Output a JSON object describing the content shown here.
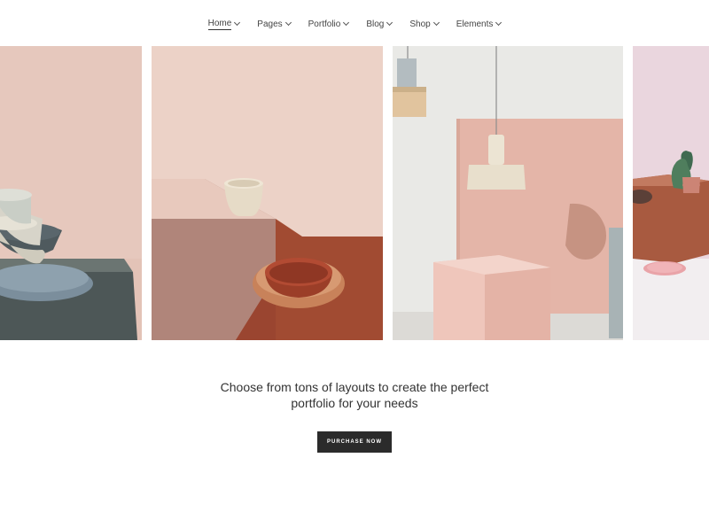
{
  "nav": {
    "items": [
      {
        "label": "Home",
        "active": true
      },
      {
        "label": "Pages"
      },
      {
        "label": "Portfolio"
      },
      {
        "label": "Blog"
      },
      {
        "label": "Shop"
      },
      {
        "label": "Elements"
      }
    ]
  },
  "gallery": {
    "tiles": [
      "ceramic-bowls-image",
      "ceramic-cup-bowl-image",
      "pendant-lamp-image",
      "green-vase-image"
    ]
  },
  "tagline": {
    "line1": "Choose from tons of layouts to create the perfect",
    "line2": "portfolio for your needs"
  },
  "cta": {
    "label": "PURCHASE NOW"
  },
  "colors": {
    "accent": "#2b2b2b",
    "pink": "#e8c6ba",
    "terracotta": "#a5563f"
  }
}
